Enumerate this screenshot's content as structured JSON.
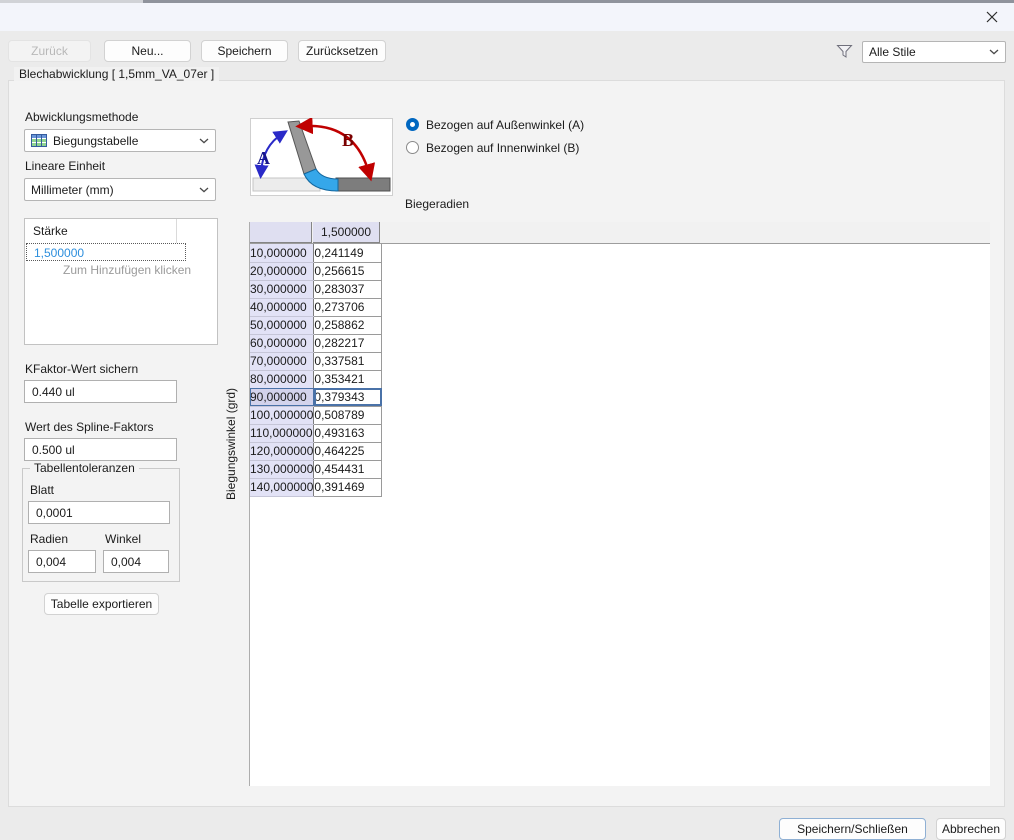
{
  "window": {
    "icons": [
      "close-icon",
      "filter-icon",
      "bend-table-icon",
      "chevron-down-icon"
    ]
  },
  "toolbar": {
    "back_label": "Zurück",
    "new_label": "Neu...",
    "save_label": "Speichern",
    "reset_label": "Zurücksetzen",
    "style_filter_value": "Alle Stile"
  },
  "group_title": "Blechabwicklung [ 1,5mm_VA_07er ]",
  "left_panel": {
    "method_label": "Abwicklungsmethode",
    "method_value": "Biegungstabelle",
    "unit_label": "Lineare Einheit",
    "unit_value": "Millimeter (mm)",
    "thickness": {
      "header": "Stärke",
      "value": "1,500000",
      "hint": "Zum Hinzufügen klicken"
    },
    "kfactor_label": "KFaktor-Wert sichern",
    "kfactor_value": "0.440 ul",
    "spline_label": "Wert des Spline-Faktors",
    "spline_value": "0.500 ul",
    "tolerances": {
      "title": "Tabellentoleranzen",
      "sheet_label": "Blatt",
      "sheet_value": "0,0001",
      "radii_label": "Radien",
      "angle_label": "Winkel",
      "radii_value": "0,004",
      "angle_value": "0,004"
    },
    "export_button": "Tabelle exportieren"
  },
  "right_panel": {
    "diagram_labels": {
      "a": "A",
      "b": "B"
    },
    "radios": [
      {
        "label": "Bezogen auf Außenwinkel (A)",
        "selected": true
      },
      {
        "label": "Bezogen auf Innenwinkel (B)",
        "selected": false
      }
    ],
    "table_title": "Biegeradien",
    "y_axis_label": "Biegungswinkel (grd)"
  },
  "bend_table": {
    "type": "table",
    "column_header": "1,500000",
    "selected_row": "90,000000",
    "rows": [
      {
        "angle": "10,000000",
        "value": "0,241149"
      },
      {
        "angle": "20,000000",
        "value": "0,256615"
      },
      {
        "angle": "30,000000",
        "value": "0,283037"
      },
      {
        "angle": "40,000000",
        "value": "0,273706"
      },
      {
        "angle": "50,000000",
        "value": "0,258862"
      },
      {
        "angle": "60,000000",
        "value": "0,282217"
      },
      {
        "angle": "70,000000",
        "value": "0,337581"
      },
      {
        "angle": "80,000000",
        "value": "0,353421"
      },
      {
        "angle": "90,000000",
        "value": "0,379343"
      },
      {
        "angle": "100,000000",
        "value": "0,508789"
      },
      {
        "angle": "110,000000",
        "value": "0,493163"
      },
      {
        "angle": "120,000000",
        "value": "0,464225"
      },
      {
        "angle": "130,000000",
        "value": "0,454431"
      },
      {
        "angle": "140,000000",
        "value": "0,391469"
      }
    ]
  },
  "footer": {
    "save_close_label": "Speichern/Schließen",
    "cancel_label": "Abbrechen"
  },
  "colors": {
    "accent_blue": "#0067c0",
    "selection_border": "#4a72a8",
    "header_lavender": "#dfdff1",
    "row_header_lavender": "#e2e2f6",
    "thickness_value_blue": "#2d8fdd",
    "arrow_a_blue": "#2a2ac8",
    "arrow_b_red": "#c00000"
  }
}
